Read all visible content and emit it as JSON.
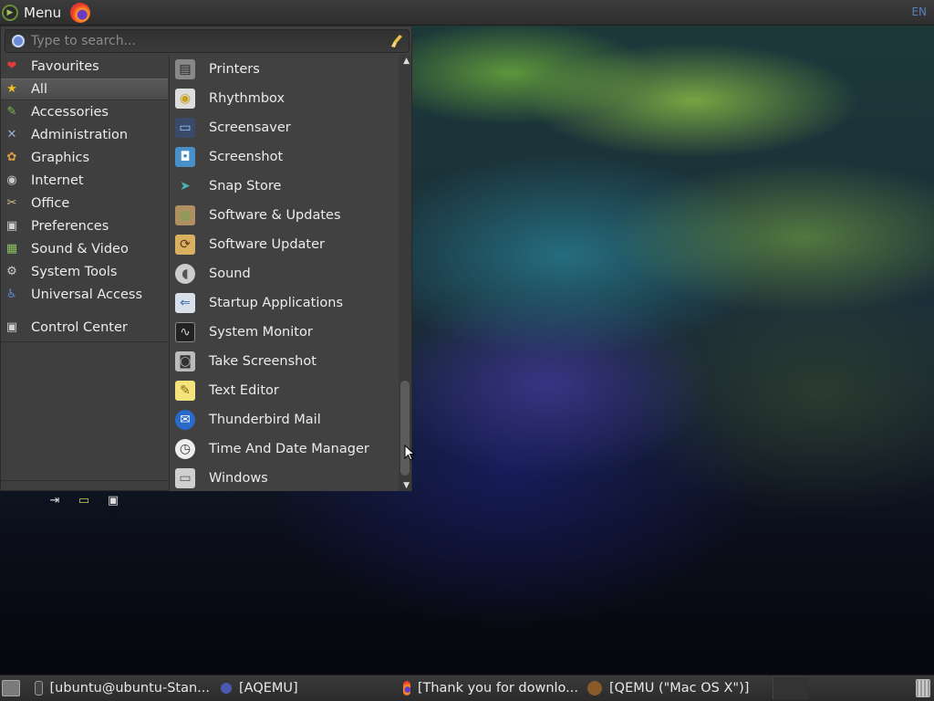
{
  "top_panel": {
    "menu_label": "Menu",
    "keyboard_layout": "EN"
  },
  "menu": {
    "search": {
      "placeholder": "Type to search..."
    },
    "categories": [
      {
        "label": "Favourites",
        "icon": "heart-icon",
        "selected": false
      },
      {
        "label": "All",
        "icon": "star-icon",
        "selected": true
      },
      {
        "label": "Accessories",
        "icon": "accessories-icon",
        "selected": false
      },
      {
        "label": "Administration",
        "icon": "tools-icon",
        "selected": false
      },
      {
        "label": "Graphics",
        "icon": "palette-icon",
        "selected": false
      },
      {
        "label": "Internet",
        "icon": "globe-icon",
        "selected": false
      },
      {
        "label": "Office",
        "icon": "office-icon",
        "selected": false
      },
      {
        "label": "Preferences",
        "icon": "preferences-icon",
        "selected": false
      },
      {
        "label": "Sound & Video",
        "icon": "film-icon",
        "selected": false
      },
      {
        "label": "System Tools",
        "icon": "gear-icon",
        "selected": false
      },
      {
        "label": "Universal Access",
        "icon": "accessibility-icon",
        "selected": false
      }
    ],
    "control_center": "Control Center",
    "system_buttons": [
      "logout-icon",
      "lock-screen-icon",
      "shutdown-icon"
    ],
    "apps": [
      {
        "label": "Printers",
        "icon": "printer-icon"
      },
      {
        "label": "Rhythmbox",
        "icon": "rhythmbox-icon"
      },
      {
        "label": "Screensaver",
        "icon": "screensaver-icon"
      },
      {
        "label": "Screenshot",
        "icon": "screenshot-icon"
      },
      {
        "label": "Snap Store",
        "icon": "snap-store-icon"
      },
      {
        "label": "Software & Updates",
        "icon": "software-updates-icon"
      },
      {
        "label": "Software Updater",
        "icon": "software-updater-icon"
      },
      {
        "label": "Sound",
        "icon": "speaker-icon"
      },
      {
        "label": "Startup Applications",
        "icon": "startup-icon"
      },
      {
        "label": "System Monitor",
        "icon": "system-monitor-icon"
      },
      {
        "label": "Take Screenshot",
        "icon": "camera-icon"
      },
      {
        "label": "Text Editor",
        "icon": "text-editor-icon"
      },
      {
        "label": "Thunderbird Mail",
        "icon": "thunderbird-icon"
      },
      {
        "label": "Time And Date Manager",
        "icon": "clock-icon"
      },
      {
        "label": "Windows",
        "icon": "windows-icon"
      }
    ]
  },
  "taskbar": {
    "items": [
      {
        "label": "[ubuntu@ubuntu-Stan...",
        "icon": "terminal-icon"
      },
      {
        "label": "[AQEMU]",
        "icon": "aqemu-icon"
      },
      {
        "label": "[Thank you for downlo...",
        "icon": "firefox-icon"
      },
      {
        "label": "[QEMU (\"Mac OS X\")]",
        "icon": "qemu-icon"
      }
    ]
  },
  "colors": {
    "menu_bg": "#3f3f3f",
    "panel_bg": "#2e2e2e",
    "selected_bg": "#555555",
    "accent_blue": "#5a7fc0"
  }
}
